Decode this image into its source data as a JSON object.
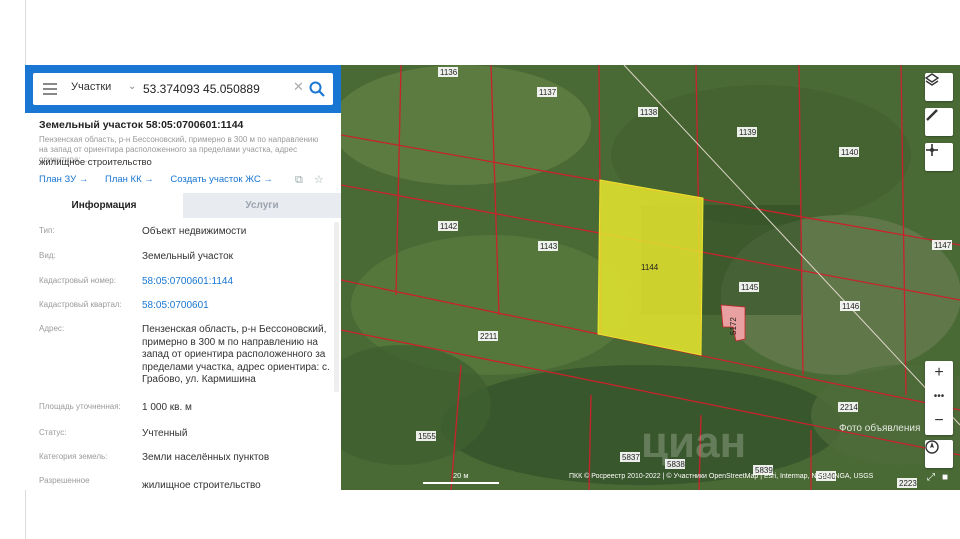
{
  "search": {
    "type_label": "Участки",
    "query": "53.374093 45.050889"
  },
  "parcel": {
    "title": "Земельный участок 58:05:0700601:1144",
    "address_short": "Пензенская область, р-н Бессоновский, примерно в 300 м по направлению на запад от ориентира расположенного за пределами участка, адрес ориентира: ...",
    "use": "жилищное строительство"
  },
  "links": {
    "plan_zu": "План ЗУ →",
    "plan_kk": "План КК →",
    "create": "Создать участок ЖС →"
  },
  "tabs": {
    "info": "Информация",
    "services": "Услуги"
  },
  "properties": [
    {
      "key": "Тип:",
      "value": "Объект недвижимости"
    },
    {
      "key": "Вид:",
      "value": "Земельный участок"
    },
    {
      "key": "Кадастровый номер:",
      "value": "58:05:0700601:1144"
    },
    {
      "key": "Кадастровый квартал:",
      "value": "58:05:0700601"
    },
    {
      "key": "Адрес:",
      "value": "Пензенская область, р-н Бессоновский, примерно в 300 м по направлению на запад от ориентира расположенного за пределами участка, адрес ориентира: с. Грабово, ул. Кармишина"
    },
    {
      "key": "Площадь уточненная:",
      "value": "1 000 кв. м"
    },
    {
      "key": "Статус:",
      "value": "Учтенный"
    },
    {
      "key": "Категория земель:",
      "value": "Земли населённых пунктов"
    },
    {
      "key": "Разрешенное",
      "value": "жилищное строительство"
    }
  ],
  "map": {
    "parcel_labels": [
      "1136",
      "1137",
      "1138",
      "1139",
      "1140",
      "1142",
      "1143",
      "1144",
      "1145",
      "1146",
      "1147",
      "2211",
      "2214",
      "1555",
      "5837",
      "5838",
      "5839",
      "5840",
      "2223",
      "5172"
    ],
    "scale": "20 м",
    "attribution": "ПКК © Росреестр 2010-2022 | © Участники OpenStreetMap | Esri, Intermap, NASA, NGA, USGS",
    "watermark": "Фото объявления",
    "watermark_brand": "циан"
  },
  "colors": {
    "accent": "#1976d2",
    "parcel_fill": "#e6e62e",
    "boundary": "#c8232c",
    "building": "#e8a0a0"
  }
}
